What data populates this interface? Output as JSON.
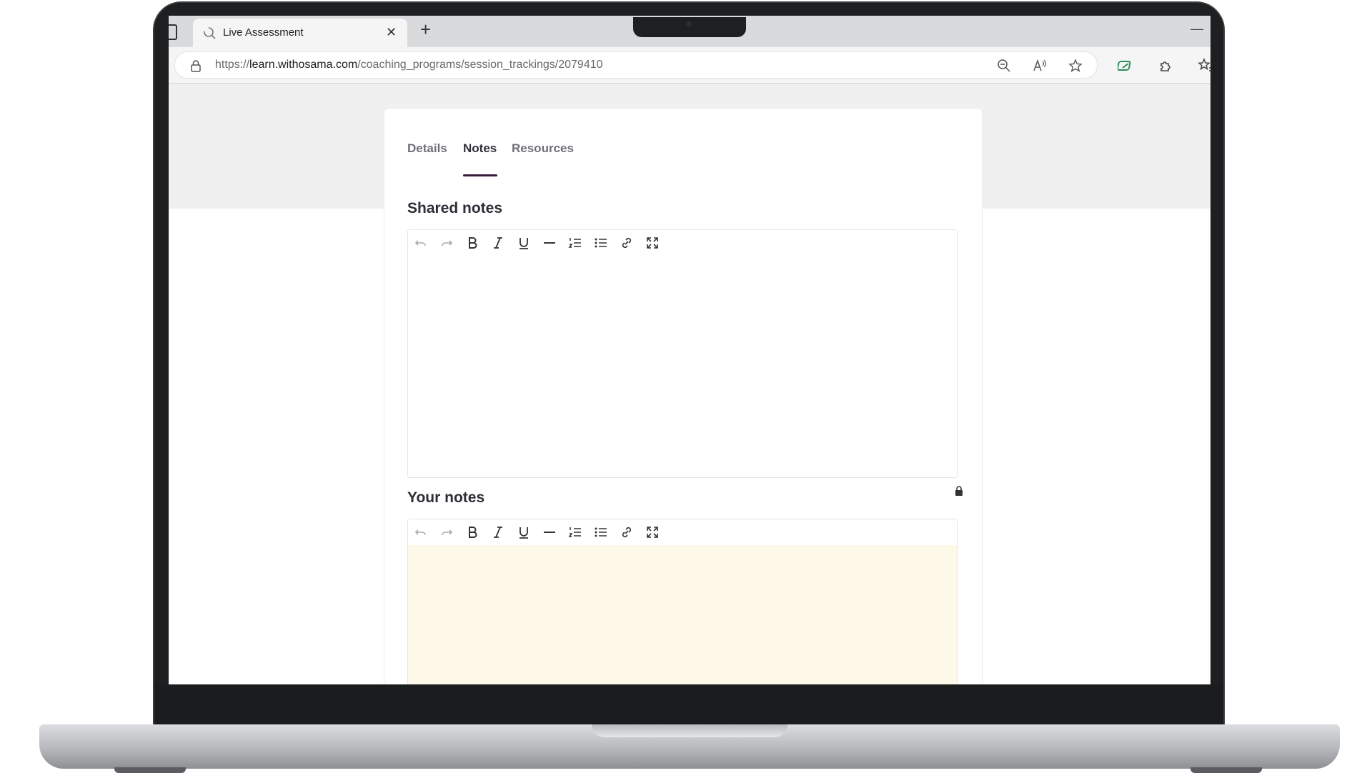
{
  "browser": {
    "tab_title": "Live Assessment",
    "tab_close": "✕",
    "new_tab": "+",
    "minimize": "—",
    "url_scheme": "https://",
    "url_host": "learn.withosama.com",
    "url_path": "/coaching_programs/session_trackings/2079410"
  },
  "page": {
    "tabs": [
      {
        "label": "Details"
      },
      {
        "label": "Notes"
      },
      {
        "label": "Resources"
      }
    ],
    "active_tab": "Notes",
    "shared_notes": {
      "title": "Shared notes",
      "content": ""
    },
    "your_notes": {
      "title": "Your notes",
      "content": "",
      "background": "#fdf8e8"
    },
    "toolbar_icons": [
      "undo-icon",
      "redo-icon",
      "bold-icon",
      "italic-icon",
      "underline-icon",
      "horizontal-rule-icon",
      "ordered-list-icon",
      "bullet-list-icon",
      "link-icon",
      "fullscreen-icon"
    ]
  },
  "colors": {
    "accent": "#3a1b3a",
    "page_gray": "#f0f0f1",
    "private_note_bg": "#fdf8e8"
  }
}
